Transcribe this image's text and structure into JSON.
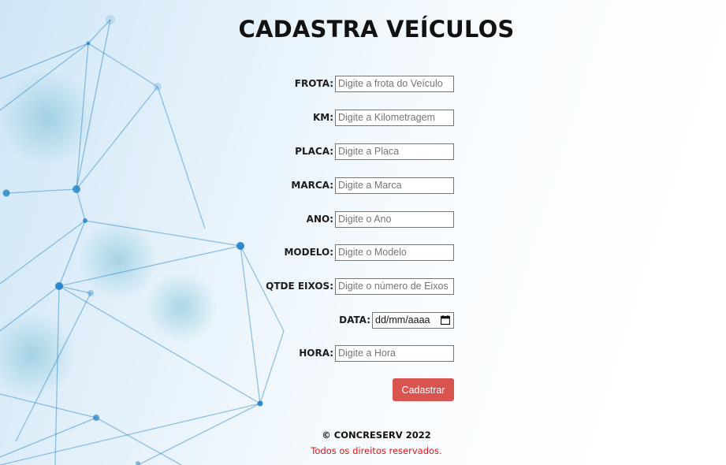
{
  "title": "CADASTRA VEÍCULOS",
  "fields": {
    "frota": {
      "label": "FROTA:",
      "placeholder": "Digite a frota do Veículo"
    },
    "km": {
      "label": "KM:",
      "placeholder": "Digite a Kilometragem"
    },
    "placa": {
      "label": "PLACA:",
      "placeholder": "Digite a Placa"
    },
    "marca": {
      "label": "MARCA:",
      "placeholder": "Digite a Marca"
    },
    "ano": {
      "label": "ANO:",
      "placeholder": "Digite o Ano"
    },
    "modelo": {
      "label": "MODELO:",
      "placeholder": "Digite o Modelo"
    },
    "qtde_eixos": {
      "label": "QTDE EIXOS:",
      "placeholder": "Digite o número de Eixos"
    },
    "data": {
      "label": "DATA:",
      "value": "dd/mm/aaaa",
      "icon": "calendar-icon"
    },
    "hora": {
      "label": "HORA:",
      "placeholder": "Digite a Hora"
    }
  },
  "submit_label": "Cadastrar",
  "footer": {
    "copyright": "© CONCRESERV 2022",
    "rights": "Todos os direitos reservados."
  },
  "colors": {
    "submit_bg": "#d9534f",
    "rights_text": "#e0161a",
    "network_lines": "#1f7fc4"
  }
}
